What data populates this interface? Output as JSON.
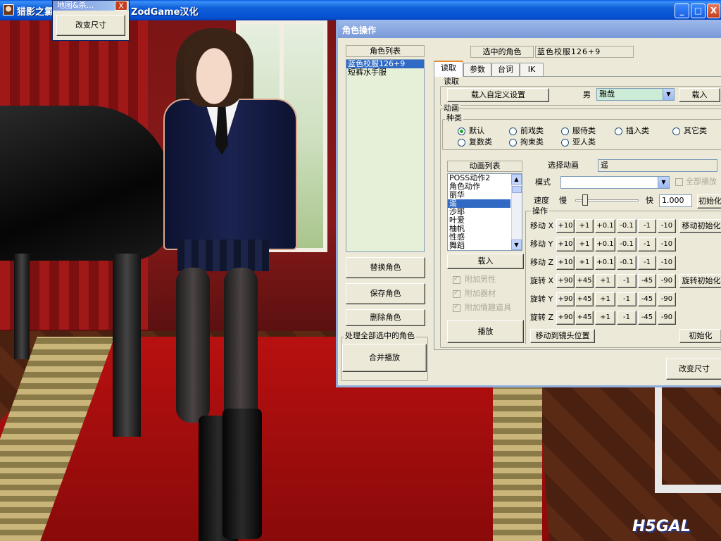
{
  "window": {
    "title": "猎影之氯",
    "title_tail": "ZodGame汉化",
    "btn_min": "_",
    "btn_max": "□",
    "btn_close": "X"
  },
  "popup": {
    "title": "地图&杀...",
    "close": "X",
    "resize_button": "改变尺寸"
  },
  "dialog": {
    "title": "角色操作",
    "role_list_label": "角色列表",
    "role_list": [
      "蓝色校服126+9",
      "短裤水手服"
    ],
    "role_list_selected_index": 0,
    "selected_role_label": "选中的角色",
    "selected_role_value": "蓝色校服126+9",
    "tabs": [
      "读取",
      "参数",
      "台词",
      "IK"
    ],
    "active_tab": "读取",
    "buttons": {
      "replace": "替换角色",
      "save": "保存角色",
      "delete": "删除角色",
      "merge_play": "合并播放",
      "resize": "改变尺寸"
    },
    "process_all_label": "处理全部选中的角色",
    "read_group": {
      "label": "读取",
      "load_custom": "载入自定义设置",
      "gender_label": "男",
      "gender_value": "雅哉",
      "load": "载入"
    },
    "anim_group": {
      "label": "动画",
      "category_label": "种类",
      "categories_row1": [
        "默认",
        "前戏类",
        "服侍类",
        "插入类",
        "其它类"
      ],
      "categories_row2": [
        "复数类",
        "拘束类",
        "亚人类"
      ],
      "selected_category": "默认",
      "list_label": "动画列表",
      "list": [
        "POSS动作2",
        "角色动作",
        "丽华",
        "遥",
        "沙耶",
        "叶爱",
        "柚帆",
        "性感",
        "舞蹈"
      ],
      "list_selected": "遥",
      "load": "载入",
      "play": "播放",
      "checkboxes": [
        "附加男性",
        "附加器材",
        "附加情趣道具"
      ],
      "select_anim_label": "选择动画",
      "select_anim_value": "遥",
      "mode_label": "模式",
      "mode_value": "",
      "all_play": "全部播放",
      "speed_label": "速度",
      "speed_slow": "慢",
      "speed_fast": "快",
      "speed_value": "1.000",
      "speed_slider_fraction": 0.12,
      "init": "初始化"
    },
    "ops": {
      "label": "操作",
      "move_x": "移动 X",
      "move_y": "移动 Y",
      "move_z": "移动 Z",
      "rot_x": "旋转 X",
      "rot_y": "旋转 Y",
      "rot_z": "旋转 Z",
      "move_steps": [
        "+10",
        "+1",
        "+0.1",
        "-0.1",
        "-1",
        "-10"
      ],
      "rot_steps": [
        "+90",
        "+45",
        "+1",
        "-1",
        "-45",
        "-90"
      ],
      "move_init": "移动初始化",
      "rot_init": "旋转初始化",
      "move_to_camera": "移动到镜头位置",
      "init": "初始化"
    }
  },
  "watermark": "H5GAL"
}
